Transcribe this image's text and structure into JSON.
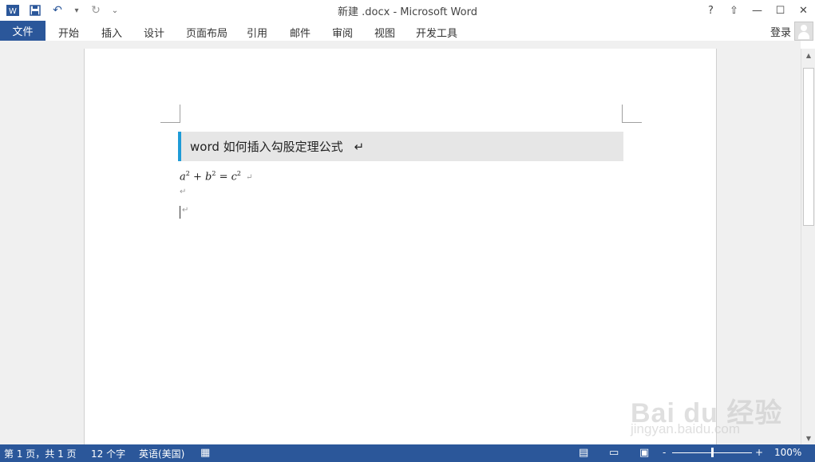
{
  "window": {
    "title": "新建 .docx - Microsoft Word",
    "controls": {
      "help": "?",
      "ribbon_display": "⇧",
      "minimize": "—",
      "maximize": "☐",
      "close": "✕"
    }
  },
  "quick_access": {
    "word_icon": "W",
    "save_icon": "💾",
    "undo_icon": "↶",
    "undo_dropdown": "▾",
    "redo_icon": "↻",
    "customize": "⌄"
  },
  "ribbon": {
    "file_tab": "文件",
    "tabs": [
      "开始",
      "插入",
      "设计",
      "页面布局",
      "引用",
      "邮件",
      "审阅",
      "视图",
      "开发工具"
    ],
    "login": "登录"
  },
  "document": {
    "heading": "word  如何插入勾股定理公式",
    "paragraph_mark": "↵",
    "equation": {
      "a": "a",
      "b": "b",
      "c": "c",
      "exp": "2",
      "plus": " + ",
      "equals": " = "
    }
  },
  "scrollbar": {
    "up": "▲",
    "down": "▼"
  },
  "watermark": {
    "brand": "Bai du 经验",
    "url": "jingyan.baidu.com"
  },
  "status": {
    "page": "第 1 页，共 1 页",
    "words": "12 个字",
    "language": "英语(美国)",
    "zoom_level": "100%",
    "zoom_minus": "-",
    "zoom_plus": "+",
    "zoom_fraction": 0.5
  },
  "colors": {
    "accent": "#2b579a",
    "heading_bar": "#1e9bd7"
  }
}
